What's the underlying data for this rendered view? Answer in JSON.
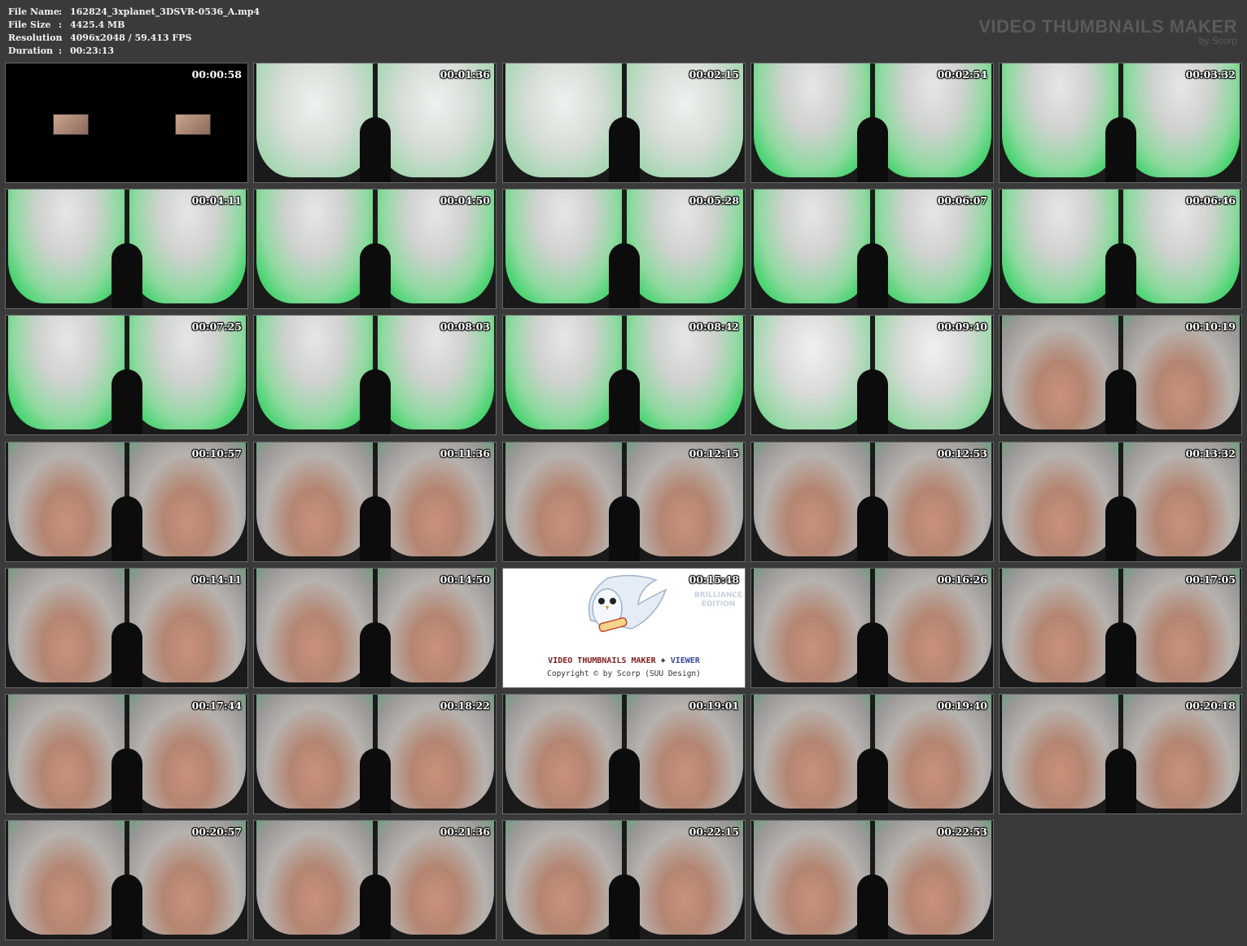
{
  "file_info": {
    "rows": [
      {
        "label": "File Name",
        "value": "162824_3xplanet_3DSVR-0536_A.mp4"
      },
      {
        "label": "File Size",
        "value": "4425.4 MB"
      },
      {
        "label": "Resolution",
        "value": "4096x2048 / 59.413 FPS"
      },
      {
        "label": "Duration",
        "value": "00:23:13"
      }
    ],
    "separator": ":"
  },
  "brand": {
    "title": "VIDEO THUMBNAILS MAKER",
    "subtitle": "by Scorp"
  },
  "logo_tile": {
    "edition": "BRILLIANCE EDITION",
    "name_a": "VIDEO THUMBNAILS MAKER",
    "name_plus": " + ",
    "name_b": "VIEWER",
    "copyright": "Copyright © by Scorp (SUU Design)"
  },
  "thumbnails": [
    {
      "time": "00:00:58",
      "kind": "black"
    },
    {
      "time": "00:01:36",
      "kind": "pale"
    },
    {
      "time": "00:02:15",
      "kind": "pale"
    },
    {
      "time": "00:02:54",
      "kind": "green"
    },
    {
      "time": "00:03:32",
      "kind": "green"
    },
    {
      "time": "00:04:11",
      "kind": "green"
    },
    {
      "time": "00:04:50",
      "kind": "green"
    },
    {
      "time": "00:05:28",
      "kind": "green"
    },
    {
      "time": "00:06:07",
      "kind": "green"
    },
    {
      "time": "00:06:46",
      "kind": "green"
    },
    {
      "time": "00:07:25",
      "kind": "green"
    },
    {
      "time": "00:08:03",
      "kind": "green"
    },
    {
      "time": "00:08:42",
      "kind": "green"
    },
    {
      "time": "00:09:40",
      "kind": "greenpale"
    },
    {
      "time": "00:10:19",
      "kind": "room"
    },
    {
      "time": "00:10:57",
      "kind": "room"
    },
    {
      "time": "00:11:36",
      "kind": "room"
    },
    {
      "time": "00:12:15",
      "kind": "room"
    },
    {
      "time": "00:12:53",
      "kind": "room"
    },
    {
      "time": "00:13:32",
      "kind": "room"
    },
    {
      "time": "00:14:11",
      "kind": "room"
    },
    {
      "time": "00:14:50",
      "kind": "room"
    },
    {
      "time": "00:15:48",
      "kind": "logo"
    },
    {
      "time": "00:16:26",
      "kind": "room"
    },
    {
      "time": "00:17:05",
      "kind": "room"
    },
    {
      "time": "00:17:44",
      "kind": "room"
    },
    {
      "time": "00:18:22",
      "kind": "room"
    },
    {
      "time": "00:19:01",
      "kind": "room"
    },
    {
      "time": "00:19:40",
      "kind": "room"
    },
    {
      "time": "00:20:18",
      "kind": "room"
    },
    {
      "time": "00:20:57",
      "kind": "room"
    },
    {
      "time": "00:21:36",
      "kind": "room"
    },
    {
      "time": "00:22:15",
      "kind": "room"
    },
    {
      "time": "00:22:53",
      "kind": "room"
    }
  ],
  "colors": {
    "background": "#3a3a3a",
    "tile_border": "#6a6a6a",
    "green": "#3fd46a",
    "pale": "#d6dcd6",
    "skin": "#c9917a",
    "room": "#b7b2ae"
  }
}
